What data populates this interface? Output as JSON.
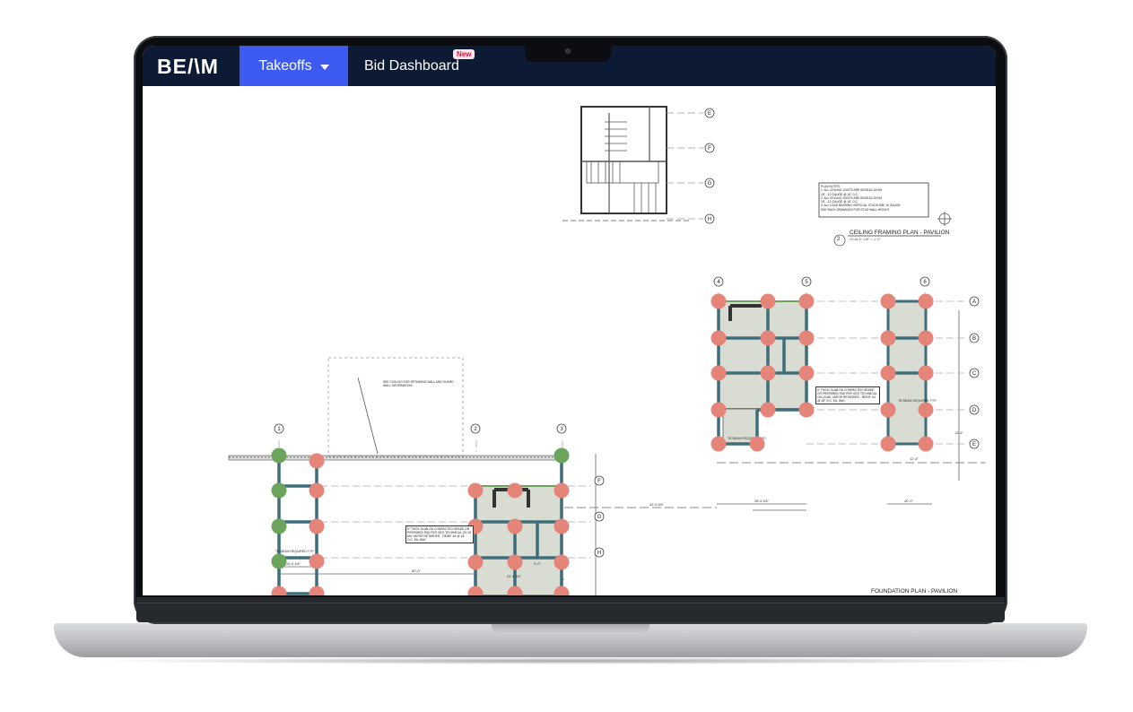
{
  "nav": {
    "logo": "BE/\\M",
    "tabs": [
      {
        "label": "Takeoffs"
      },
      {
        "label": "Bid Dashboard",
        "badge": "New"
      }
    ]
  },
  "drawing": {
    "ceiling_plan_title": "CEILING FRAMING PLAN - PAVILION",
    "ceiling_plan_scale": "SCALE: 1/8\" = 1'-0\"",
    "ceiling_plan_number": "2",
    "foundation_plan_title": "FOUNDATION PLAN - PAVILION",
    "plan_notes_heading": "PLAN NOTES:",
    "plan_notes": [
      "1.  ALL CEILING JOISTS ARE 600S162-33 KM",
      "    18\" - 12 GAUGE @ 16\" O.C.",
      "2.  ALL CEILING JOISTS ARE 600S162-33 KM",
      "    18\" - 12 GAUGE @ 16\" O.C.",
      "3.  ALL LOAD BEARING VERTICAL STUDS ARE 16 GAUGE",
      "    SEE RACK DRAWINGS FOR STUD WALL HEIGHT"
    ],
    "retaining_wall_note": "SEE CIVIL/OO FOR RETAINING WALL AND GUARD WALL INFORMATION",
    "slab_note": "5\" THICK SLAB ON COMPACTED GRADE OR PREPARED PAD PER GEO TECHNICAL ON 15 MIL VAPOR RETARDER - REINF. #4 @ 18\" O.C. EA. WAY",
    "grid_columns": [
      "1",
      "2",
      "3",
      "4",
      "5",
      "6"
    ],
    "grid_rows_right": [
      "A",
      "B",
      "C",
      "D",
      "E"
    ],
    "grid_rows_left": [
      "F",
      "G",
      "H"
    ],
    "grid_rows_top": [
      "E",
      "F",
      "G",
      "H"
    ],
    "dimensions": [
      "80'-0\"",
      "24'-6 3/4\"",
      "15'-6 3/4\"",
      "9'-0\"",
      "42'-6 3/4\"",
      "28'-6 3/4\"",
      "40'-0\"",
      "12'-6\"",
      "13'-6\""
    ],
    "beam_label": "TB BEAM REQUIRED TYP."
  },
  "marker_colors": {
    "salmon": "#e5857a",
    "green": "#6ba45a",
    "line": "#3d6e7a",
    "fill": "#d9dcd3"
  }
}
